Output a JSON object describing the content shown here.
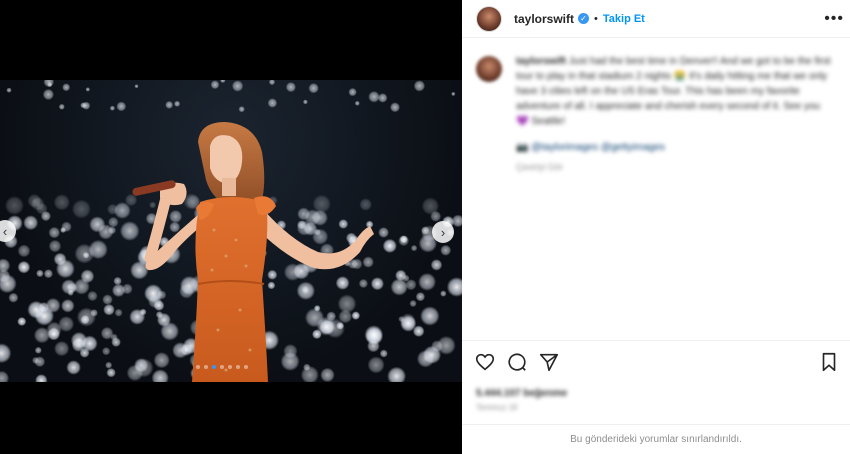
{
  "post": {
    "username": "taylorswift",
    "separator": "•",
    "follow_label": "Takip Et",
    "more_icon": "more-horizontal-icon",
    "verified_icon": "verified-badge-icon"
  },
  "caption": {
    "username": "taylorswift",
    "text": "Just had the best time in Denver!! And we got to be the first tour to play in that stadium 2 nights 😭 It's daily hitting me that we only have 3 cities left on the US Eras Tour. This has been my favorite adventure of all. I appreciate and cherish every second of it. See you 💜 Seattle!",
    "tags": "📷 @taylorimages @gettyimages",
    "time": "Çeviriyi Gör"
  },
  "stats": {
    "likes": "5.444.107 beğenme",
    "date": "Temmuz 18"
  },
  "comments_notice": "Bu gönderideki yorumlar sınırlandırıldı.",
  "media": {
    "dot_count": 7,
    "active_dot": 2,
    "prev_icon": "chevron-left-icon",
    "next_icon": "chevron-right-icon"
  },
  "actions": [
    "heart-icon",
    "comment-icon",
    "share-icon",
    "bookmark-icon"
  ]
}
